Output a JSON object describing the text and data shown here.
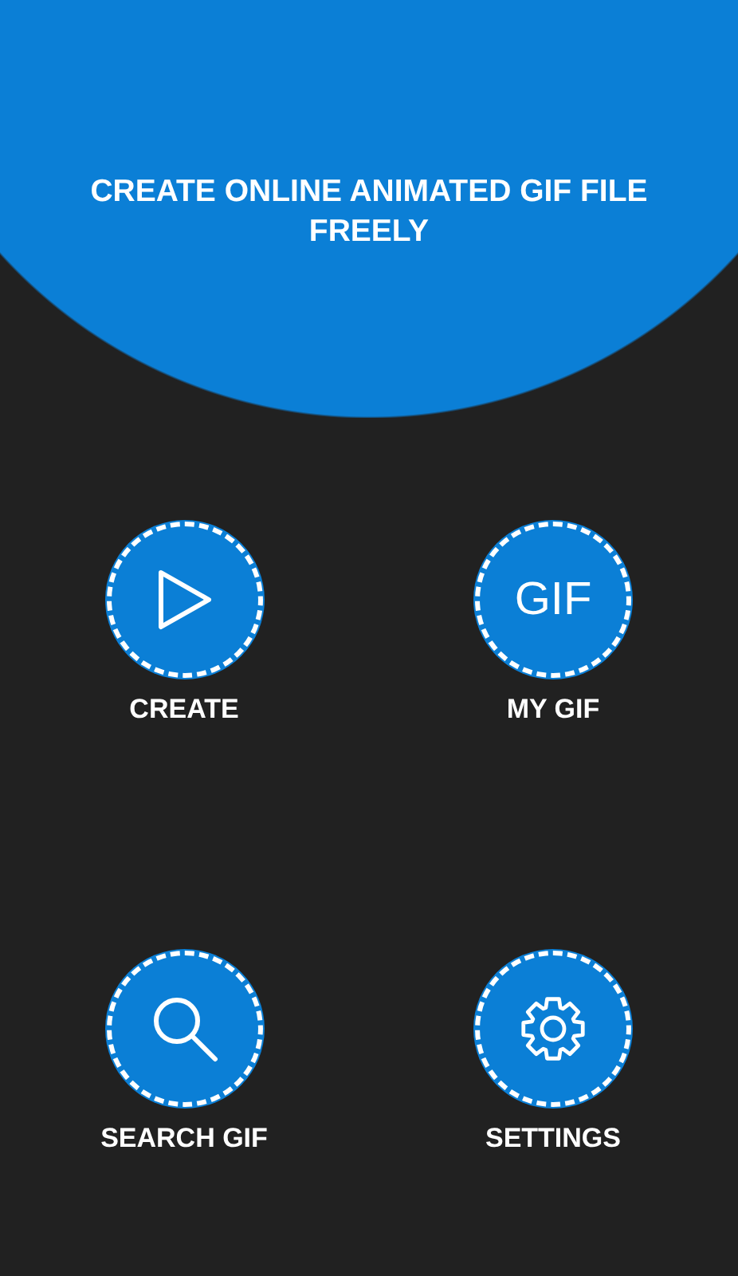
{
  "header": {
    "title": "CREATE ONLINE ANIMATED GIF FILE FREELY"
  },
  "menu_rows": [
    {
      "buttons": [
        {
          "kind": "play"
        },
        {
          "kind": "gif",
          "icon_text": "GIF"
        }
      ],
      "labels": [
        "CREATE",
        "MY GIF"
      ]
    },
    {
      "buttons": [
        {
          "kind": "search"
        },
        {
          "kind": "gear"
        }
      ],
      "labels": [
        "SEARCH GIF",
        "SETTINGS"
      ]
    }
  ]
}
